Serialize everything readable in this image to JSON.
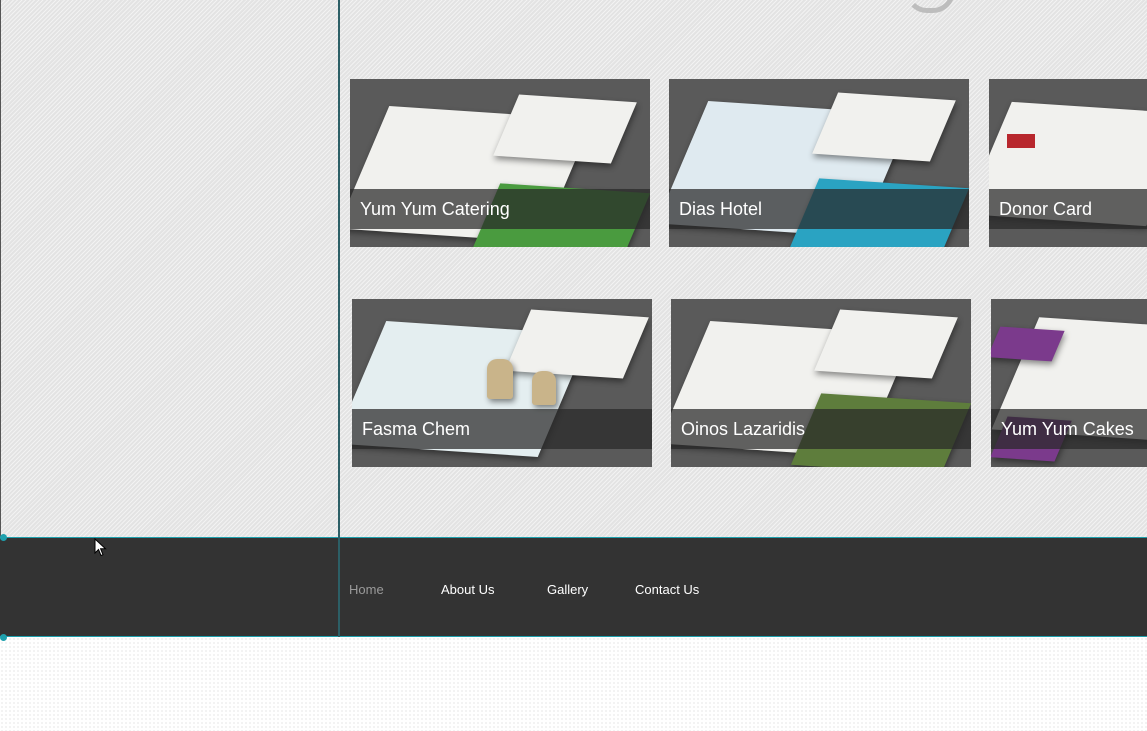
{
  "gallery": {
    "items": [
      {
        "title": "Yum Yum Catering",
        "accent": "#4a9b3f"
      },
      {
        "title": "Dias Hotel",
        "accent": "#2aa3c2"
      },
      {
        "title": "Donor Card",
        "accent": "#b8272d"
      },
      {
        "title": "Fasma Chem",
        "accent": "#5aa8b8"
      },
      {
        "title": "Oinos Lazaridis",
        "accent": "#8fbf5a"
      },
      {
        "title": "Yum Yum Cakes",
        "accent": "#7b3a8c"
      }
    ]
  },
  "nav": {
    "items": [
      {
        "label": "Home",
        "active": true
      },
      {
        "label": "About Us",
        "active": false
      },
      {
        "label": "Gallery",
        "active": false
      },
      {
        "label": "Contact Us",
        "active": false
      }
    ]
  },
  "colors": {
    "nav_background": "#333333",
    "guide_line": "#1ea0ad",
    "active_nav_text": "#9a9a9a"
  }
}
